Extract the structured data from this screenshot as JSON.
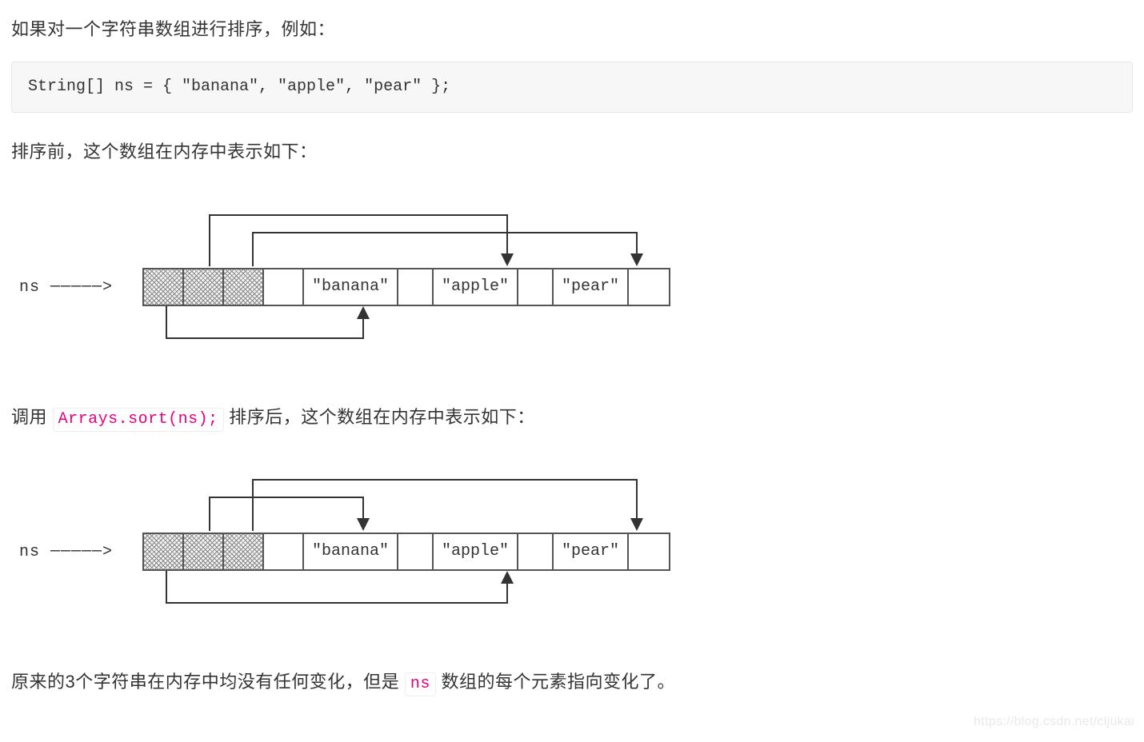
{
  "p1": "如果对一个字符串数组进行排序，例如：",
  "code_block": "String[] ns = { \"banana\", \"apple\", \"pear\" };",
  "p2": "排序前，这个数组在内存中表示如下：",
  "p3_before": "调用",
  "p3_code": "Arrays.sort(ns);",
  "p3_after": "排序后，这个数组在内存中表示如下：",
  "p4_before": "原来的3个字符串在内存中均没有任何变化，但是",
  "p4_code": "ns",
  "p4_after": "数组的每个元素指向变化了。",
  "diagram": {
    "ns_arrow_label": "ns ─────>",
    "strings": [
      "\"banana\"",
      "\"apple\"",
      "\"pear\""
    ],
    "before_pointers": {
      "ptr0_to": "banana",
      "ptr1_to": "apple",
      "ptr2_to": "pear"
    },
    "after_pointers": {
      "ptr0_to": "apple",
      "ptr1_to": "banana",
      "ptr2_to": "pear"
    }
  },
  "watermark": "https://blog.csdn.net/cljukai"
}
